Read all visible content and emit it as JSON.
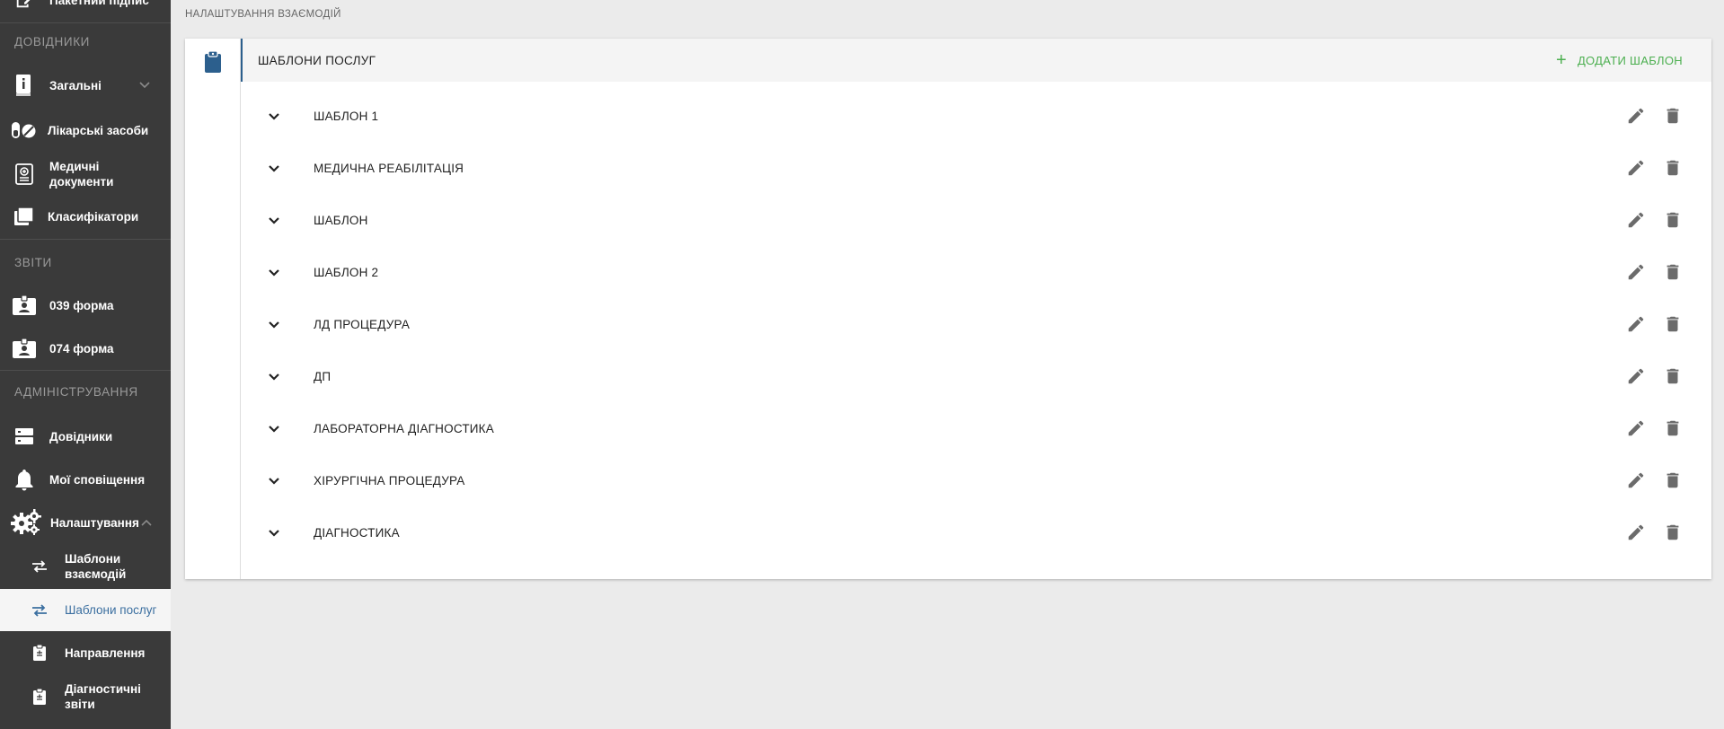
{
  "sidebar": {
    "top_partial_label": "Пакетний підпис",
    "sections": {
      "references": "ДОВІДНИКИ",
      "reports": "ЗВІТИ",
      "administration": "АДМІНІСТРУВАННЯ"
    },
    "items": {
      "general": "Загальні",
      "medicines": "Лікарські засоби",
      "medical_documents": "Медичні документи",
      "classifiers": "Класифікатори",
      "form_039": "039 форма",
      "form_074": "074 форма",
      "directories": "Довідники",
      "my_notifications": "Мої сповіщення",
      "settings": "Налаштування"
    },
    "sub_items": {
      "interaction_templates": "Шаблони взаємодій",
      "service_templates": "Шаблони послуг",
      "referrals": "Направлення",
      "diagnostic_reports": "Діагностичні звіти"
    }
  },
  "breadcrumb": "НАЛАШТУВАННЯ ВЗАЄМОДІЙ",
  "card": {
    "title": "ШАБЛОНИ ПОСЛУГ",
    "add_label": "ДОДАТИ ШАБЛОН",
    "templates": [
      "ШАБЛОН 1",
      "МЕДИЧНА РЕАБІЛІТАЦІЯ",
      "ШАБЛОН",
      "ШАБЛОН 2",
      "ЛД ПРОЦЕДУРА",
      "ДП",
      "ЛАБОРАТОРНА ДІАГНОСТИКА",
      "ХІРУРГІЧНА ПРОЦЕДУРА",
      "ДІАГНОСТИКА"
    ]
  },
  "colors": {
    "sidebar_bg": "#3a3a3a",
    "accent_blue": "#2c5f8d",
    "add_green": "#4caf50",
    "active_text": "#3b6fa0"
  }
}
